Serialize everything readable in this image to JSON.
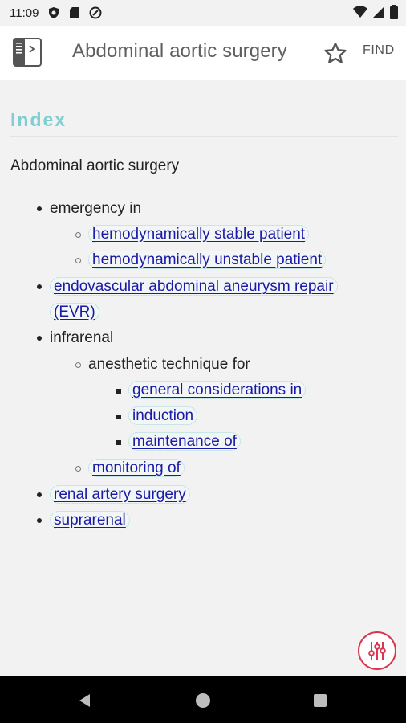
{
  "status_bar": {
    "time": "11:09"
  },
  "app_bar": {
    "title": "Abdominal aortic surgery",
    "find_label": "FIND"
  },
  "index": {
    "section_title": "Index",
    "heading": "Abdominal aortic surgery",
    "entries": {
      "emergency": "emergency in",
      "stable": "hemodynamically stable patient",
      "unstable": "hemodynamically unstable patient",
      "evr_line1": "endovascular abdominal aneurysm repair",
      "evr_line2": "(EVR)",
      "infrarenal": "infrarenal",
      "anesthetic": "anesthetic technique for",
      "general": "general considerations in",
      "induction": "induction",
      "maintenance": "maintenance of",
      "monitoring": "monitoring of",
      "renal": "renal artery surgery",
      "suprarenal": "suprarenal"
    }
  },
  "colors": {
    "accent_teal": "#7fcfd2",
    "link_blue": "#1a1aa6",
    "fab_red": "#d9364f"
  }
}
